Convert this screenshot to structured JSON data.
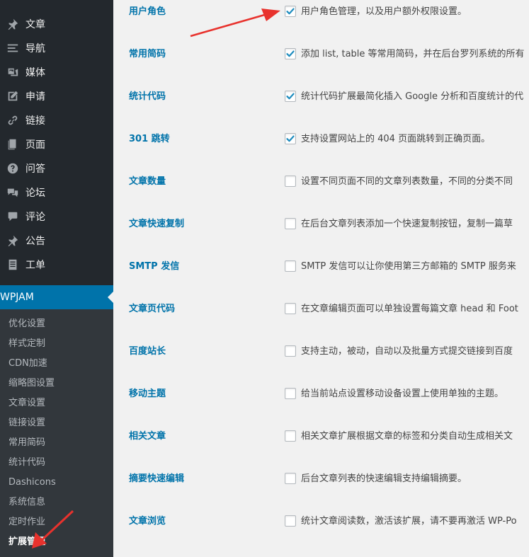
{
  "sidebar": {
    "menu": [
      {
        "label": "文章",
        "icon": "pin-icon"
      },
      {
        "label": "导航",
        "icon": "menu-icon"
      },
      {
        "label": "媒体",
        "icon": "media-icon"
      },
      {
        "label": "申请",
        "icon": "edit-icon"
      },
      {
        "label": "链接",
        "icon": "link-icon"
      },
      {
        "label": "页面",
        "icon": "page-icon"
      },
      {
        "label": "问答",
        "icon": "question-icon"
      },
      {
        "label": "论坛",
        "icon": "forum-icon"
      },
      {
        "label": "评论",
        "icon": "comment-icon"
      },
      {
        "label": "公告",
        "icon": "pin-icon"
      },
      {
        "label": "工单",
        "icon": "ticket-icon"
      }
    ],
    "current": {
      "label": "WPJAM",
      "icon": "dashboard-icon"
    },
    "submenu": [
      "优化设置",
      "样式定制",
      "CDN加速",
      "缩略图设置",
      "文章设置",
      "链接设置",
      "常用简码",
      "统计代码",
      "Dashicons",
      "系统信息",
      "定时作业",
      "扩展管理"
    ],
    "submenu_current": "扩展管理"
  },
  "settings": [
    {
      "label": "用户角色",
      "checked": true,
      "desc": "用户角色管理，以及用户额外权限设置。"
    },
    {
      "label": "常用简码",
      "checked": true,
      "desc": "添加 list, table 等常用简码，并在后台罗列系统的所有"
    },
    {
      "label": "统计代码",
      "checked": true,
      "desc": "统计代码扩展最简化插入 Google 分析和百度统计的代"
    },
    {
      "label": "301 跳转",
      "checked": true,
      "desc": "支持设置网站上的 404 页面跳转到正确页面。"
    },
    {
      "label": "文章数量",
      "checked": false,
      "desc": "设置不同页面不同的文章列表数量，不同的分类不同"
    },
    {
      "label": "文章快速复制",
      "checked": false,
      "desc": "在后台文章列表添加一个快速复制按钮，复制一篇草"
    },
    {
      "label": "SMTP 发信",
      "checked": false,
      "desc": "SMTP 发信可以让你使用第三方邮箱的 SMTP 服务来"
    },
    {
      "label": "文章页代码",
      "checked": false,
      "desc": "在文章编辑页面可以单独设置每篇文章 head 和 Foot"
    },
    {
      "label": "百度站长",
      "checked": false,
      "desc": "支持主动，被动，自动以及批量方式提交链接到百度"
    },
    {
      "label": "移动主题",
      "checked": false,
      "desc": "给当前站点设置移动设备设置上使用单独的主题。"
    },
    {
      "label": "相关文章",
      "checked": false,
      "desc": "相关文章扩展根据文章的标签和分类自动生成相关文"
    },
    {
      "label": "摘要快速编辑",
      "checked": false,
      "desc": "后台文章列表的快速编辑支持编辑摘要。"
    },
    {
      "label": "文章浏览",
      "checked": false,
      "desc": "统计文章阅读数，激活该扩展，请不要再激活 WP-Po"
    }
  ],
  "colors": {
    "sidebar_bg": "#23282d",
    "submenu_bg": "#32373c",
    "accent": "#0073aa",
    "annotation_arrow": "#e8322d"
  }
}
